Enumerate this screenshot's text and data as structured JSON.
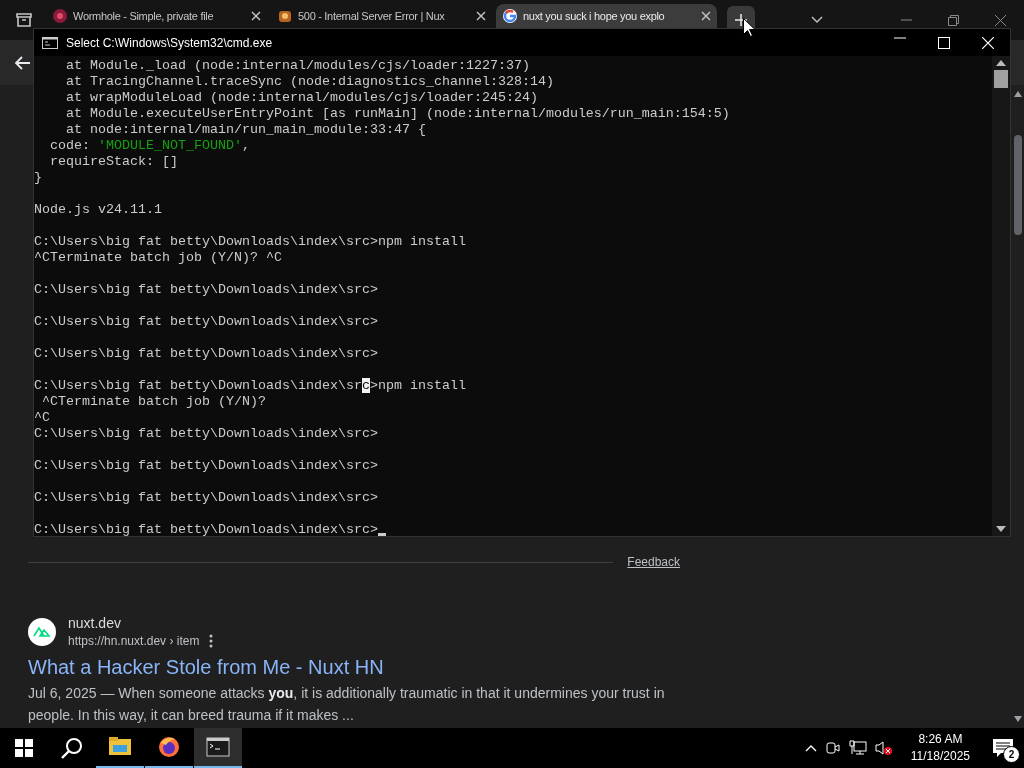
{
  "browser": {
    "tabs": [
      {
        "title": "Wormhole - Simple, private file",
        "selected": false
      },
      {
        "title": "500 - Internal Server Error | Nux",
        "selected": false
      },
      {
        "title": "nuxt you suck i hope you explo",
        "selected": true
      }
    ],
    "page": {
      "feedback": "Feedback",
      "result": {
        "site": "nuxt.dev",
        "url": "https://hn.nuxt.dev › item",
        "title": "What a Hacker Stole from Me - Nuxt HN",
        "snippet": "Jul 6, 2025 — When someone attacks **you**, it is additionally traumatic in that it undermines your trust in people. In this way, it can breed trauma if it makes ..."
      }
    }
  },
  "terminal": {
    "title": "Select C:\\Windows\\System32\\cmd.exe",
    "cursor": true,
    "blocks": [
      [
        "    at Module._load (node:internal/modules/cjs/loader:1227:37)",
        "    at TracingChannel.traceSync (node:diagnostics_channel:328:14)",
        "    at wrapModuleLoad (node:internal/modules/cjs/loader:245:24)",
        "    at Module.executeUserEntryPoint [as runMain] (node:internal/modules/run_main:154:5)",
        "    at node:internal/main/run_main_module:33:47 {",
        {
          "segments": [
            {
              "text": "  code: ",
              "kind": "plain"
            },
            {
              "text": "'MODULE_NOT_FOUND'",
              "kind": "string"
            },
            {
              "text": ",",
              "kind": "plain"
            }
          ]
        },
        "  requireStack: []",
        "}"
      ],
      [
        "Node.js v24.11.1"
      ],
      [
        "C:\\Users\\big fat betty\\Downloads\\index\\src>npm install",
        "^CTerminate batch job (Y/N)? ^C"
      ],
      [
        "C:\\Users\\big fat betty\\Downloads\\index\\src>"
      ],
      [
        "C:\\Users\\big fat betty\\Downloads\\index\\src>"
      ],
      [
        "C:\\Users\\big fat betty\\Downloads\\index\\src>"
      ],
      [
        {
          "segments": [
            {
              "text": "C:\\Users\\big fat betty\\Downloads\\index\\sr",
              "kind": "plain"
            },
            {
              "text": "c",
              "kind": "selected"
            },
            {
              "text": ">npm install",
              "kind": "plain"
            }
          ]
        },
        " ^CTerminate batch job (Y/N)?",
        "^C",
        "C:\\Users\\big fat betty\\Downloads\\index\\src>"
      ],
      [
        "C:\\Users\\big fat betty\\Downloads\\index\\src>"
      ],
      [
        "C:\\Users\\big fat betty\\Downloads\\index\\src>"
      ],
      [
        "C:\\Users\\big fat betty\\Downloads\\index\\src>"
      ]
    ]
  },
  "taskbar": {
    "apps": [
      {
        "kind": "explorer",
        "running": true,
        "active": false
      },
      {
        "kind": "firefox",
        "running": true,
        "active": false
      },
      {
        "kind": "terminal",
        "running": true,
        "active": true
      }
    ],
    "time": "8:26 AM",
    "date": "11/18/2025",
    "notifications": "2"
  }
}
